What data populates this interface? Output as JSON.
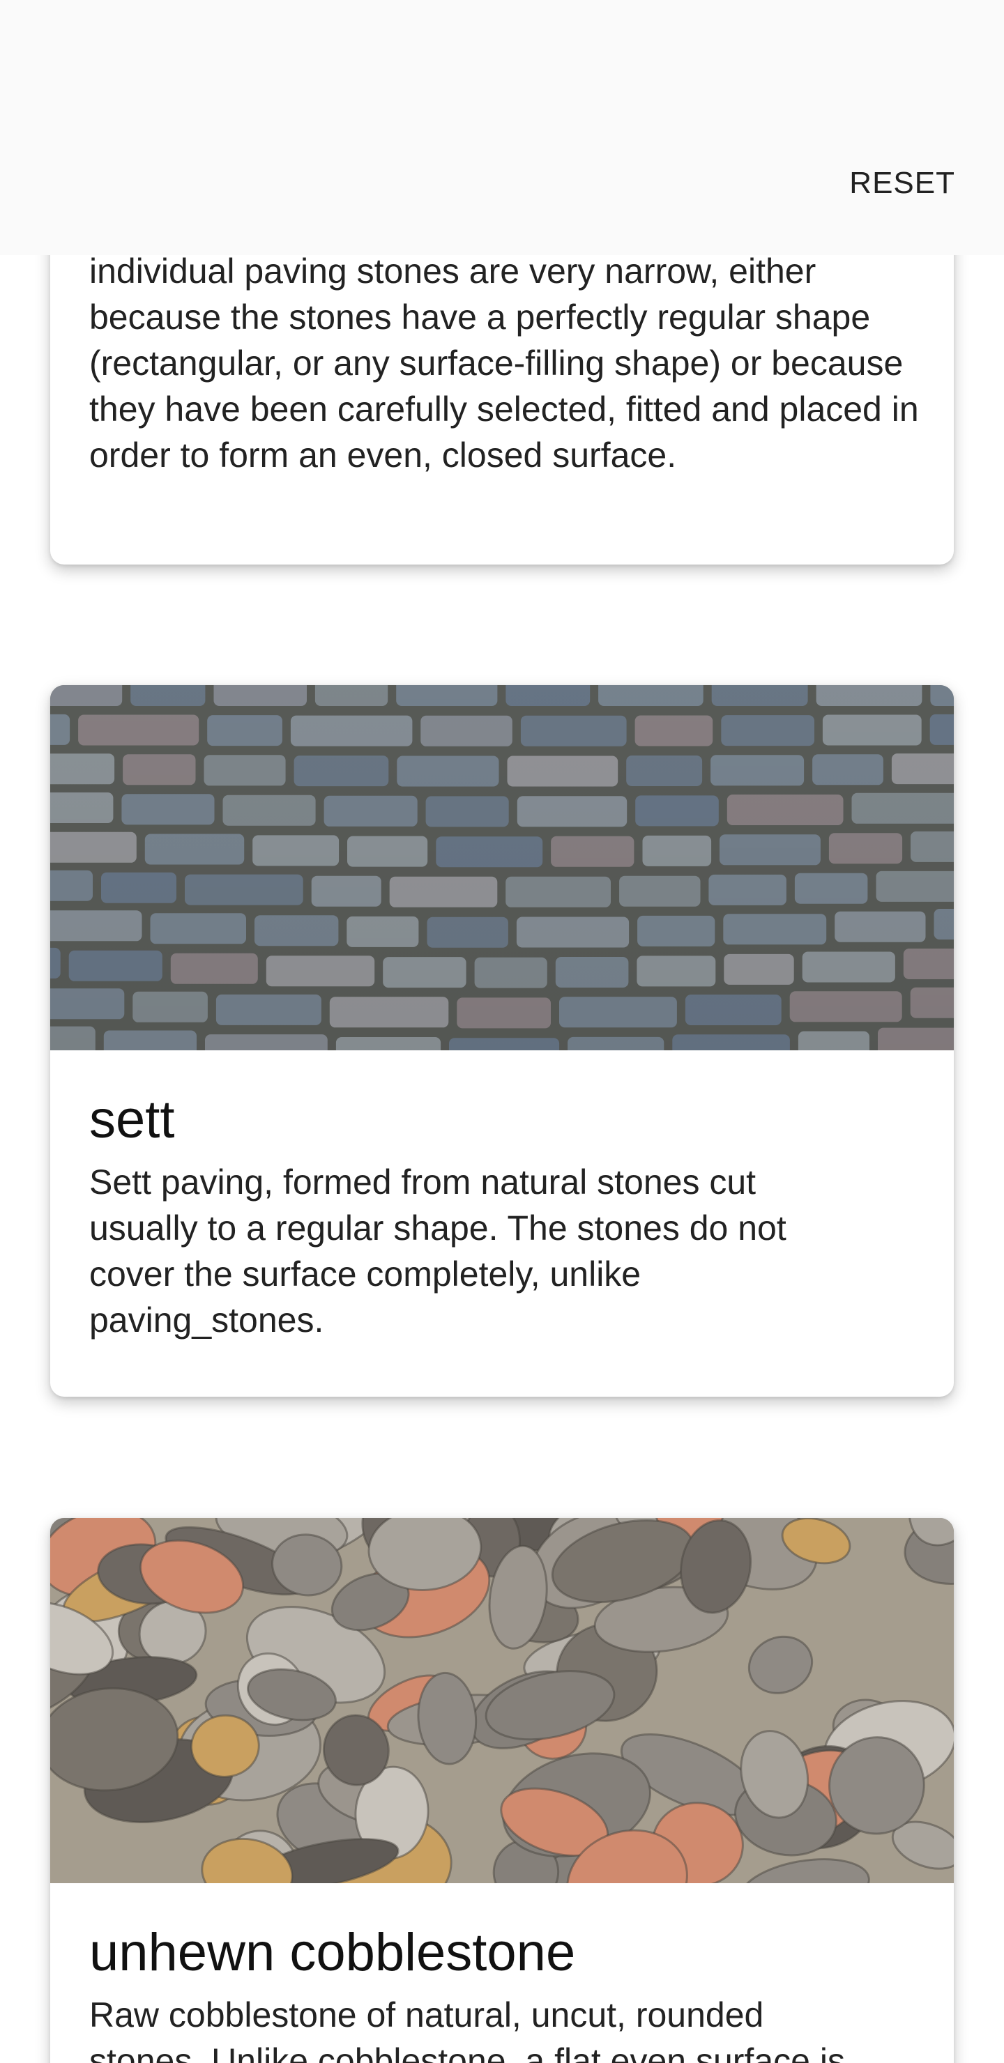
{
  "header": {
    "reset_label": "RESET"
  },
  "cards": [
    {
      "description": "individual paving stones are very narrow, either because the stones have a perfectly regular shape (rectangular, or any surface-filling shape) or because they have been carefully selected, fitted and placed in order to form an even, closed surface."
    },
    {
      "title": "sett",
      "description": "Sett paving, formed from natural stones cut usually to a regular shape. The stones do not cover the surface completely, unlike paving_stones.",
      "image_alt": "sett paving photo"
    },
    {
      "title": "unhewn cobblestone",
      "description": "Raw cobblestone of natural, uncut, rounded stones. Unlike cobblestone, a flat even surface is",
      "image_alt": "unhewn cobblestone photo"
    }
  ],
  "colors": {
    "top_bar": "#fafafa",
    "card_bg": "#ffffff",
    "text": "#222222"
  }
}
